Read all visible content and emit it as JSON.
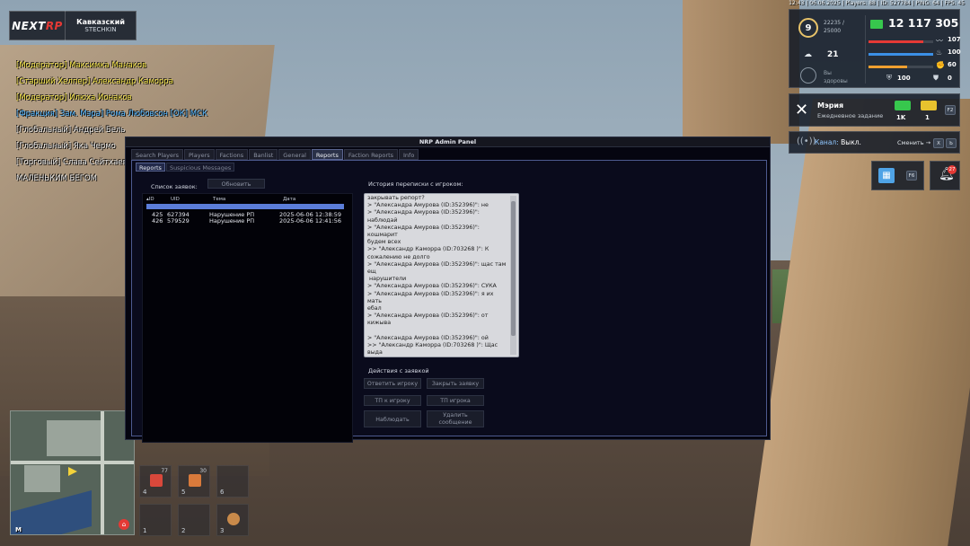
{
  "logo": {
    "brand_a": "NEXT",
    "brand_b": "RP",
    "server_name": "Кавказский",
    "server_sub": "STECHKIN"
  },
  "chat": [
    {
      "text": "[Модератор] Максимка Манаков",
      "kind": "mod"
    },
    {
      "text": "[Старший Хелпер] Александр Каморра",
      "kind": "mod"
    },
    {
      "text": "[Модератор] Илюха Ионаков",
      "kind": "mod"
    },
    {
      "text": "",
      "kind": "glob"
    },
    {
      "text": "[Фракция] Зам. Мэра] Рома Любовсон [ОК] МСК",
      "kind": "frac"
    },
    {
      "text": "[Глобальный] Андрей Бель",
      "kind": "glob"
    },
    {
      "text": "[Глобальный] Яка Чермо",
      "kind": "glob"
    },
    {
      "text": "[Торговый] Слава Сейтхаев",
      "kind": "glob"
    },
    {
      "text": "МАЛЕНЬКИМ БЕГОМ",
      "kind": "glob"
    }
  ],
  "topbar": "12:43 | 06.06.2025 | Players: 88 | ID: 527784 | PING: 64 | FPS: 45",
  "stats": {
    "level": "9",
    "exp": "22235 /",
    "exp_max": "25000",
    "money": "12 117 305",
    "rating": "21",
    "health_status_line1": "Вы",
    "health_status_line2": "здоровы",
    "bars": [
      {
        "value": "107",
        "color": "#e53935",
        "fill": 0.85
      },
      {
        "value": "100",
        "color": "#3b8fe6",
        "fill": 1.0
      },
      {
        "value": "60",
        "color": "#f0a030",
        "fill": 0.6
      }
    ],
    "armor_small": "100",
    "armor": "0"
  },
  "quest": {
    "title": "Мэрия",
    "subtitle": "Ежедневное задание",
    "reward1": "1K",
    "reward2": "1",
    "key": "F2"
  },
  "channel": {
    "label": "Канал:",
    "value": "Выкл.",
    "switch": "Сменить →",
    "key1": "X",
    "key2": "Ь"
  },
  "side": {
    "calendar_key": "F6",
    "bell_count": "27"
  },
  "minimap": {
    "label": "M"
  },
  "inventory": [
    {
      "num": "4",
      "count": "77",
      "color": "#d9483b"
    },
    {
      "num": "5",
      "count": "30",
      "color": "#d97a3b"
    },
    {
      "num": "6",
      "count": "",
      "color": ""
    },
    {
      "num": "1",
      "count": "",
      "color": ""
    },
    {
      "num": "2",
      "count": "",
      "color": ""
    },
    {
      "num": "3",
      "count": "",
      "color": "#c98a4a"
    }
  ],
  "admin": {
    "title": "NRP Admin Panel",
    "tabs": [
      "Search Players",
      "Players",
      "Factions",
      "Banlist",
      "General",
      "Reports",
      "Faction Reports",
      "Info"
    ],
    "active_tab": "Reports",
    "subtabs": [
      "Reports",
      "Suspicious Messages"
    ],
    "active_subtab": "Reports",
    "list_label": "Список заявок:",
    "refresh": "Обновить",
    "columns": [
      "ID",
      "UID",
      "Тема",
      "Дата"
    ],
    "rows": [
      {
        "id": "425",
        "uid": "627394",
        "topic": "Нарушение РП",
        "date": "2025-06-06 12:38:59"
      },
      {
        "id": "426",
        "uid": "579529",
        "topic": "Нарушение РП",
        "date": "2025-06-06 12:41:56"
      }
    ],
    "history_label": "История переписки с игроком:",
    "history": "закрывать репорт?\n> \"Александра Амурова (ID:352396)\": не\n> \"Александра Амурова (ID:352396)\": наблюдай\n> \"Александра Амурова (ID:352396)\": кошмарит\nбудем всех\n>> \"Александр Каморра (ID:703268 )\": К\nсожалению не долго\n> \"Александра Амурова (ID:352396)\": щас там ещ\n нарушители\n> \"Александра Амурова (ID:352396)\": СУКА\n> \"Александра Амурова (ID:352396)\": я их мать\nебал\n> \"Александра Амурова (ID:352396)\": от кижыва\n\n> \"Александра Амурова (ID:352396)\": ой\n>> \"Александр Каморра (ID:703268 )\": Щас выда\n\n> \"Александра Амурова (ID:352396)\": я случайн\n\n> \"Александра Амурова (ID:352396)\": не выдава\nнаказание\n> \"Александра Амурова (ID:352396)\": пж",
    "actions_label": "Действия с заявкой",
    "buttons": {
      "reply": "Ответить игроку",
      "close": "Закрыть заявку",
      "tp_to": "ТП к игроку",
      "tp_player": "ТП игрока",
      "spectate": "Наблюдать",
      "delete_line1": "Удалить",
      "delete_line2": "сообщение"
    }
  }
}
